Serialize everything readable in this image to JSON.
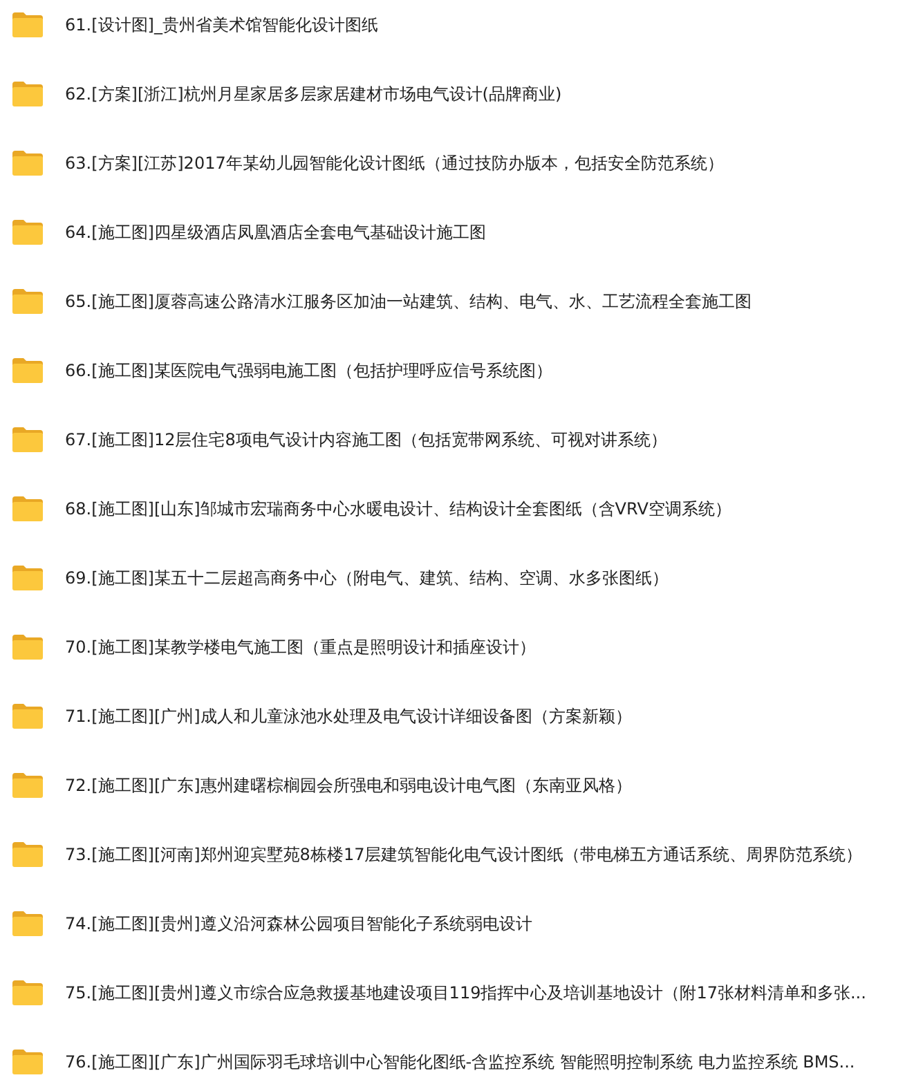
{
  "folders": [
    {
      "name": "61.[设计图]_贵州省美术馆智能化设计图纸"
    },
    {
      "name": "62.[方案][浙江]杭州月星家居多层家居建材市场电气设计(品牌商业)"
    },
    {
      "name": "63.[方案][江苏]2017年某幼儿园智能化设计图纸（通过技防办版本，包括安全防范系统）"
    },
    {
      "name": "64.[施工图]四星级酒店凤凰酒店全套电气基础设计施工图"
    },
    {
      "name": "65.[施工图]厦蓉高速公路清水江服务区加油一站建筑、结构、电气、水、工艺流程全套施工图"
    },
    {
      "name": "66.[施工图]某医院电气强弱电施工图（包括护理呼应信号系统图）"
    },
    {
      "name": "67.[施工图]12层住宅8项电气设计内容施工图（包括宽带网系统、可视对讲系统）"
    },
    {
      "name": "68.[施工图][山东]邹城市宏瑞商务中心水暖电设计、结构设计全套图纸（含VRV空调系统）"
    },
    {
      "name": "69.[施工图]某五十二层超高商务中心（附电气、建筑、结构、空调、水多张图纸）"
    },
    {
      "name": "70.[施工图]某教学楼电气施工图（重点是照明设计和插座设计）"
    },
    {
      "name": "71.[施工图][广州]成人和儿童泳池水处理及电气设计详细设备图（方案新颖）"
    },
    {
      "name": "72.[施工图][广东]惠州建曙棕榈园会所强电和弱电设计电气图（东南亚风格）"
    },
    {
      "name": "73.[施工图][河南]郑州迎宾墅苑8栋楼17层建筑智能化电气设计图纸（带电梯五方通话系统、周界防范系统）"
    },
    {
      "name": "74.[施工图][贵州]遵义沿河森林公园项目智能化子系统弱电设计"
    },
    {
      "name": "75.[施工图][贵州]遵义市综合应急救援基地建设项目119指挥中心及培训基地设计（附17张材料清单和多张..."
    },
    {
      "name": "76.[施工图][广东]广州国际羽毛球培训中心智能化图纸-含监控系统 智能照明控制系统 电力监控系统 BMS..."
    }
  ]
}
